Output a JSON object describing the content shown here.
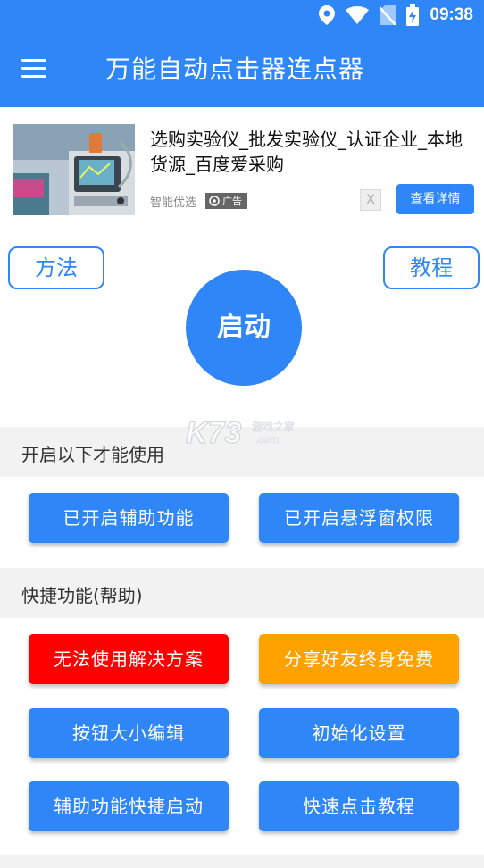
{
  "status_bar": {
    "time": "09:38",
    "icons": [
      "location-icon",
      "wifi-icon",
      "no-sim-icon",
      "battery-charging-icon"
    ]
  },
  "app_bar": {
    "title": "万能自动点击器连点器",
    "menu_icon": "hamburger-menu-icon"
  },
  "ad": {
    "title": "选购实验仪_批发实验仪_认证企业_本地货源_百度爱采购",
    "source": "智能优选",
    "tag": "广告",
    "close": "X",
    "cta": "查看详情"
  },
  "controls": {
    "method_label": "方法",
    "tutorial_label": "教程",
    "start_label": "启动"
  },
  "watermark": {
    "brand": "K73",
    "line1": "游戏之家",
    "line2": ".com"
  },
  "sections": {
    "required": {
      "title": "开启以下才能使用",
      "buttons": [
        "已开启辅助功能",
        "已开启悬浮窗权限"
      ]
    },
    "shortcuts": {
      "title": "快捷功能(帮助)",
      "buttons": [
        "无法使用解决方案",
        "分享好友终身免费",
        "按钮大小编辑",
        "初始化设置",
        "辅助功能快捷启动",
        "快速点击教程"
      ]
    }
  },
  "colors": {
    "primary": "#2f86f6",
    "danger": "#ff0000",
    "warning": "#ffa200",
    "section_bg": "#f2f2f2"
  }
}
